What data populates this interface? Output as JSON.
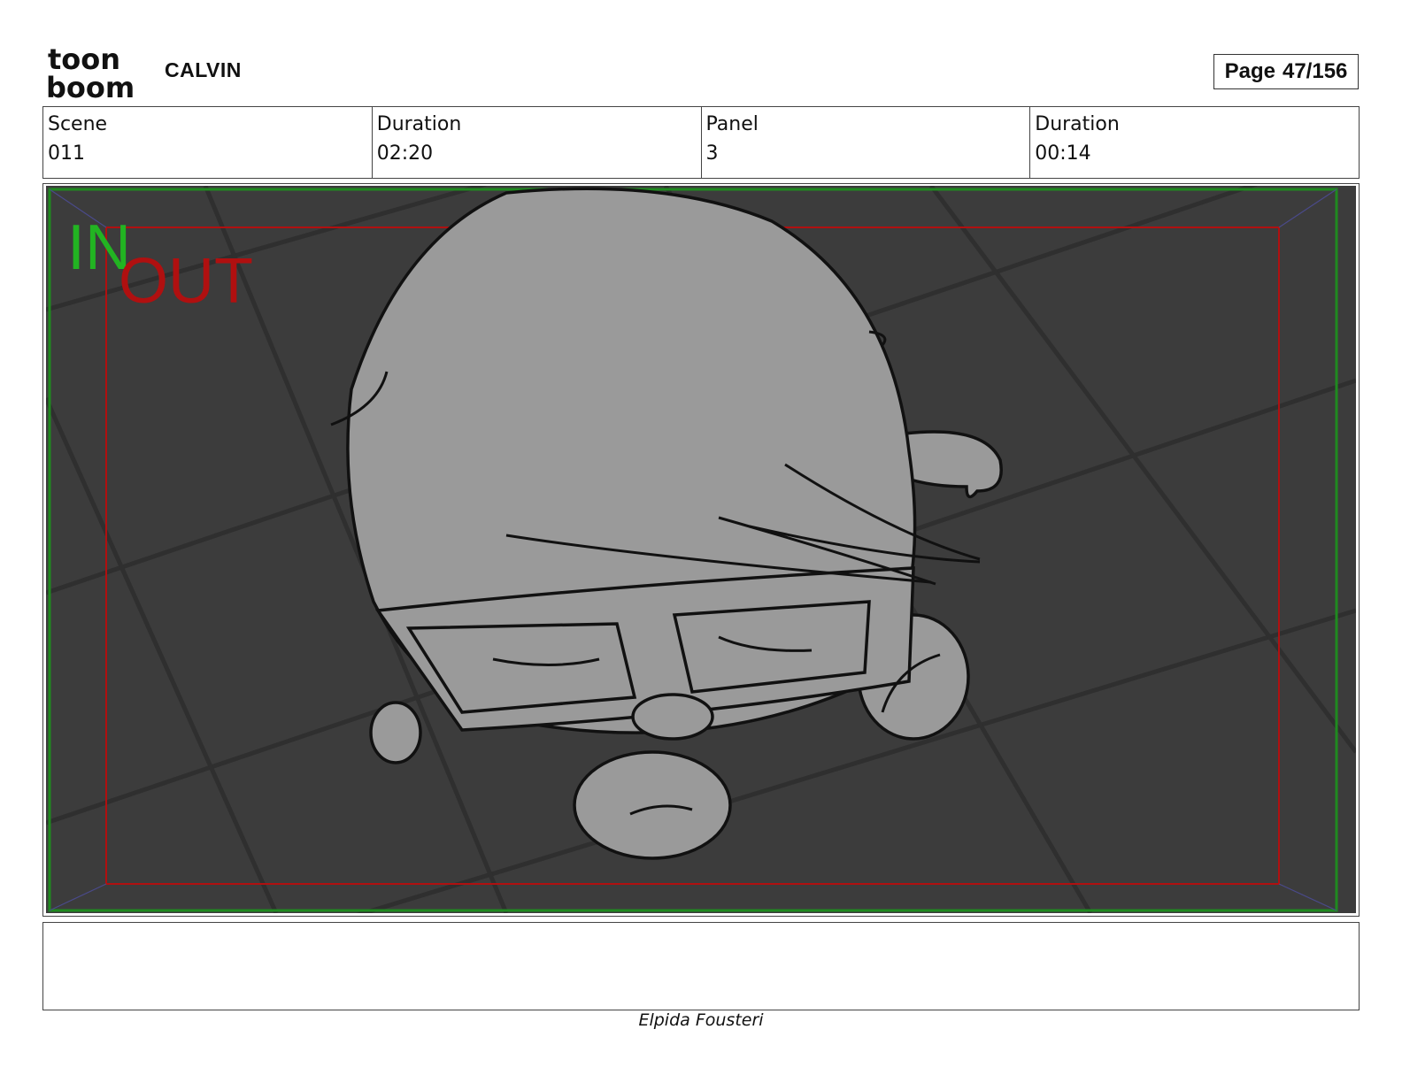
{
  "header": {
    "logo_line1": "toon",
    "logo_line2": "boom",
    "project": "CALVIN",
    "page_label": "Page",
    "page_value": "47/156"
  },
  "info": [
    {
      "label": "Scene",
      "value": "011"
    },
    {
      "label": "Duration",
      "value": "02:20"
    },
    {
      "label": "Panel",
      "value": "3"
    },
    {
      "label": "Duration",
      "value": "00:14"
    }
  ],
  "panel": {
    "in_label": "IN",
    "out_label": "OUT",
    "colors": {
      "background": "#3c3c3c",
      "character": "#9a9a9a",
      "in_frame": "#1f8a1f",
      "out_frame": "#b01010",
      "in_text": "#22b422",
      "out_text": "#b01010"
    }
  },
  "notes": "",
  "artist": "Elpida Fousteri"
}
